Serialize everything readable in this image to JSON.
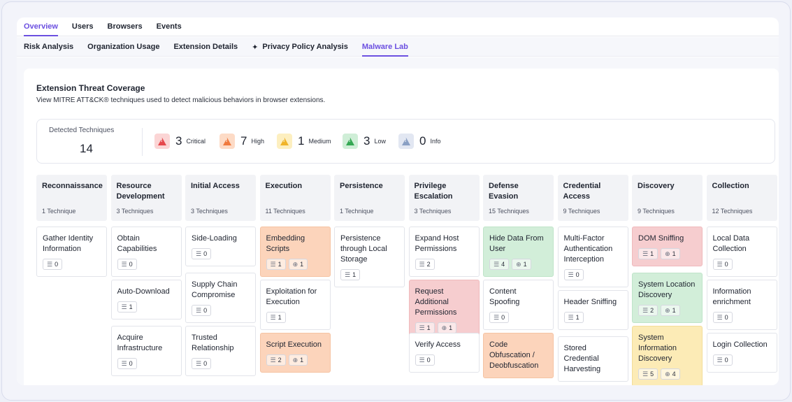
{
  "top_tabs": [
    {
      "label": "Overview",
      "active": true
    },
    {
      "label": "Users",
      "active": false
    },
    {
      "label": "Browsers",
      "active": false
    },
    {
      "label": "Events",
      "active": false
    }
  ],
  "sub_tabs": [
    {
      "label": "Risk Analysis",
      "active": false
    },
    {
      "label": "Organization Usage",
      "active": false
    },
    {
      "label": "Extension Details",
      "active": false
    },
    {
      "label": "Privacy Policy Analysis",
      "active": false,
      "icon": "sparkle-icon"
    },
    {
      "label": "Malware Lab",
      "active": true
    }
  ],
  "panel": {
    "title": "Extension Threat Coverage",
    "subtitle": "View MITRE ATT&CK® techniques used to detect malicious behaviors in browser extensions."
  },
  "summary": {
    "detected_label": "Detected Techniques",
    "detected_value": "14",
    "severities": [
      {
        "count": "3",
        "label": "Critical",
        "color": "#e5484d",
        "bg": "#fbd5d5"
      },
      {
        "count": "7",
        "label": "High",
        "color": "#f07a3e",
        "bg": "#fddbc6"
      },
      {
        "count": "1",
        "label": "Medium",
        "color": "#f0b429",
        "bg": "#fdefc0"
      },
      {
        "count": "3",
        "label": "Low",
        "color": "#34a853",
        "bg": "#cfeed7"
      },
      {
        "count": "0",
        "label": "Info",
        "color": "#8aa0c4",
        "bg": "#e2e7f2"
      }
    ]
  },
  "columns": [
    {
      "name": "Reconnaissance",
      "count": "1 Technique",
      "techniques": [
        {
          "name": "Gather Identity Information",
          "status": "none",
          "list": "0"
        }
      ]
    },
    {
      "name": "Resource Development",
      "count": "3 Techniques",
      "techniques": [
        {
          "name": "Obtain Capabilities",
          "status": "none",
          "list": "0"
        },
        {
          "name": "Auto-Download",
          "status": "none",
          "list": "1"
        },
        {
          "name": "Acquire Infrastructure",
          "status": "none",
          "list": "0"
        }
      ]
    },
    {
      "name": "Initial Access",
      "count": "3 Techniques",
      "techniques": [
        {
          "name": "Side-Loading",
          "status": "none",
          "list": "0"
        },
        {
          "name": "Supply Chain Compromise",
          "status": "none",
          "list": "0"
        },
        {
          "name": "Trusted Relationship",
          "status": "none",
          "list": "0"
        }
      ]
    },
    {
      "name": "Execution",
      "count": "11 Techniques",
      "techniques": [
        {
          "name": "Embedding Scripts",
          "status": "orange",
          "list": "1",
          "target": "1"
        },
        {
          "name": "Exploitation for Execution",
          "status": "none",
          "list": "1"
        },
        {
          "name": "Script Execution",
          "status": "orange",
          "list": "2",
          "target": "1"
        }
      ]
    },
    {
      "name": "Persistence",
      "count": "1 Technique",
      "techniques": [
        {
          "name": "Persistence through Local Storage",
          "status": "none",
          "list": "1"
        }
      ]
    },
    {
      "name": "Privilege Escalation",
      "count": "3 Techniques",
      "techniques": [
        {
          "name": "Expand Host Permissions",
          "status": "none",
          "list": "2"
        },
        {
          "name": "Request Additional Permissions",
          "status": "red",
          "list": "1",
          "target": "1"
        },
        {
          "name": "Verify Access",
          "status": "none",
          "list": "0"
        }
      ]
    },
    {
      "name": "Defense Evasion",
      "count": "15 Techniques",
      "techniques": [
        {
          "name": "Hide Data From User",
          "status": "green",
          "list": "4",
          "target": "1"
        },
        {
          "name": "Content Spoofing",
          "status": "none",
          "list": "0"
        },
        {
          "name": "Code Obfuscation / Deobfuscation",
          "status": "orange",
          "list": "",
          "target": ""
        }
      ]
    },
    {
      "name": "Credential Access",
      "count": "9 Techniques",
      "techniques": [
        {
          "name": "Multi-Factor Authentication Interception",
          "status": "none",
          "list": "0"
        },
        {
          "name": "Header Sniffing",
          "status": "none",
          "list": "1"
        },
        {
          "name": "Stored Credential Harvesting",
          "status": "none",
          "list": ""
        }
      ]
    },
    {
      "name": "Discovery",
      "count": "9 Techniques",
      "techniques": [
        {
          "name": "DOM Sniffing",
          "status": "red",
          "list": "1",
          "target": "1"
        },
        {
          "name": "System Location Discovery",
          "status": "green",
          "list": "2",
          "target": "1"
        },
        {
          "name": "System Information Discovery",
          "status": "yellow",
          "list": "5",
          "target": "4"
        }
      ]
    },
    {
      "name": "Collection",
      "count": "12 Techniques",
      "techniques": [
        {
          "name": "Local Data Collection",
          "status": "none",
          "list": "0"
        },
        {
          "name": "Information enrichment",
          "status": "none",
          "list": "0"
        },
        {
          "name": "Login Collection",
          "status": "none",
          "list": "0"
        }
      ]
    }
  ]
}
